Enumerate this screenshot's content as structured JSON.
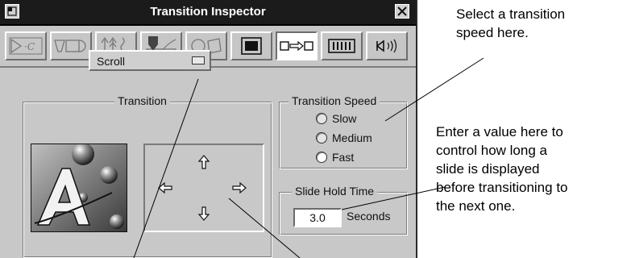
{
  "window": {
    "title": "Transition Inspector"
  },
  "toolbar": {
    "items": [
      {
        "name": "graphics-inspector-icon",
        "active": false
      },
      {
        "name": "button-inspector-icon",
        "active": false
      },
      {
        "name": "text-attributes-icon",
        "active": false
      },
      {
        "name": "pen-color-icon",
        "active": false
      },
      {
        "name": "shapes-icon",
        "active": false
      },
      {
        "name": "background-icon",
        "active": false
      },
      {
        "name": "transition-icon",
        "active": true
      },
      {
        "name": "slide-timing-icon",
        "active": false
      },
      {
        "name": "sound-icon",
        "active": false
      }
    ]
  },
  "transition": {
    "group_label": "Transition",
    "selected": "Scroll"
  },
  "transition_speed": {
    "group_label": "Transition Speed",
    "options": [
      "Slow",
      "Medium",
      "Fast"
    ],
    "selected_index": 2
  },
  "slide_hold": {
    "group_label": "Slide Hold Time",
    "value": "3.0",
    "unit": "Seconds"
  },
  "callouts": {
    "speed": [
      "Select a transition",
      "speed here."
    ],
    "hold": [
      "Enter a value here to",
      "control how long a",
      "slide is displayed",
      "before transitioning to",
      "the next one."
    ]
  },
  "colors": {
    "window_bg": "#c8c8c8",
    "titlebar_bg": "#1b1b1b",
    "active_tool_bg": "#ffffff"
  }
}
